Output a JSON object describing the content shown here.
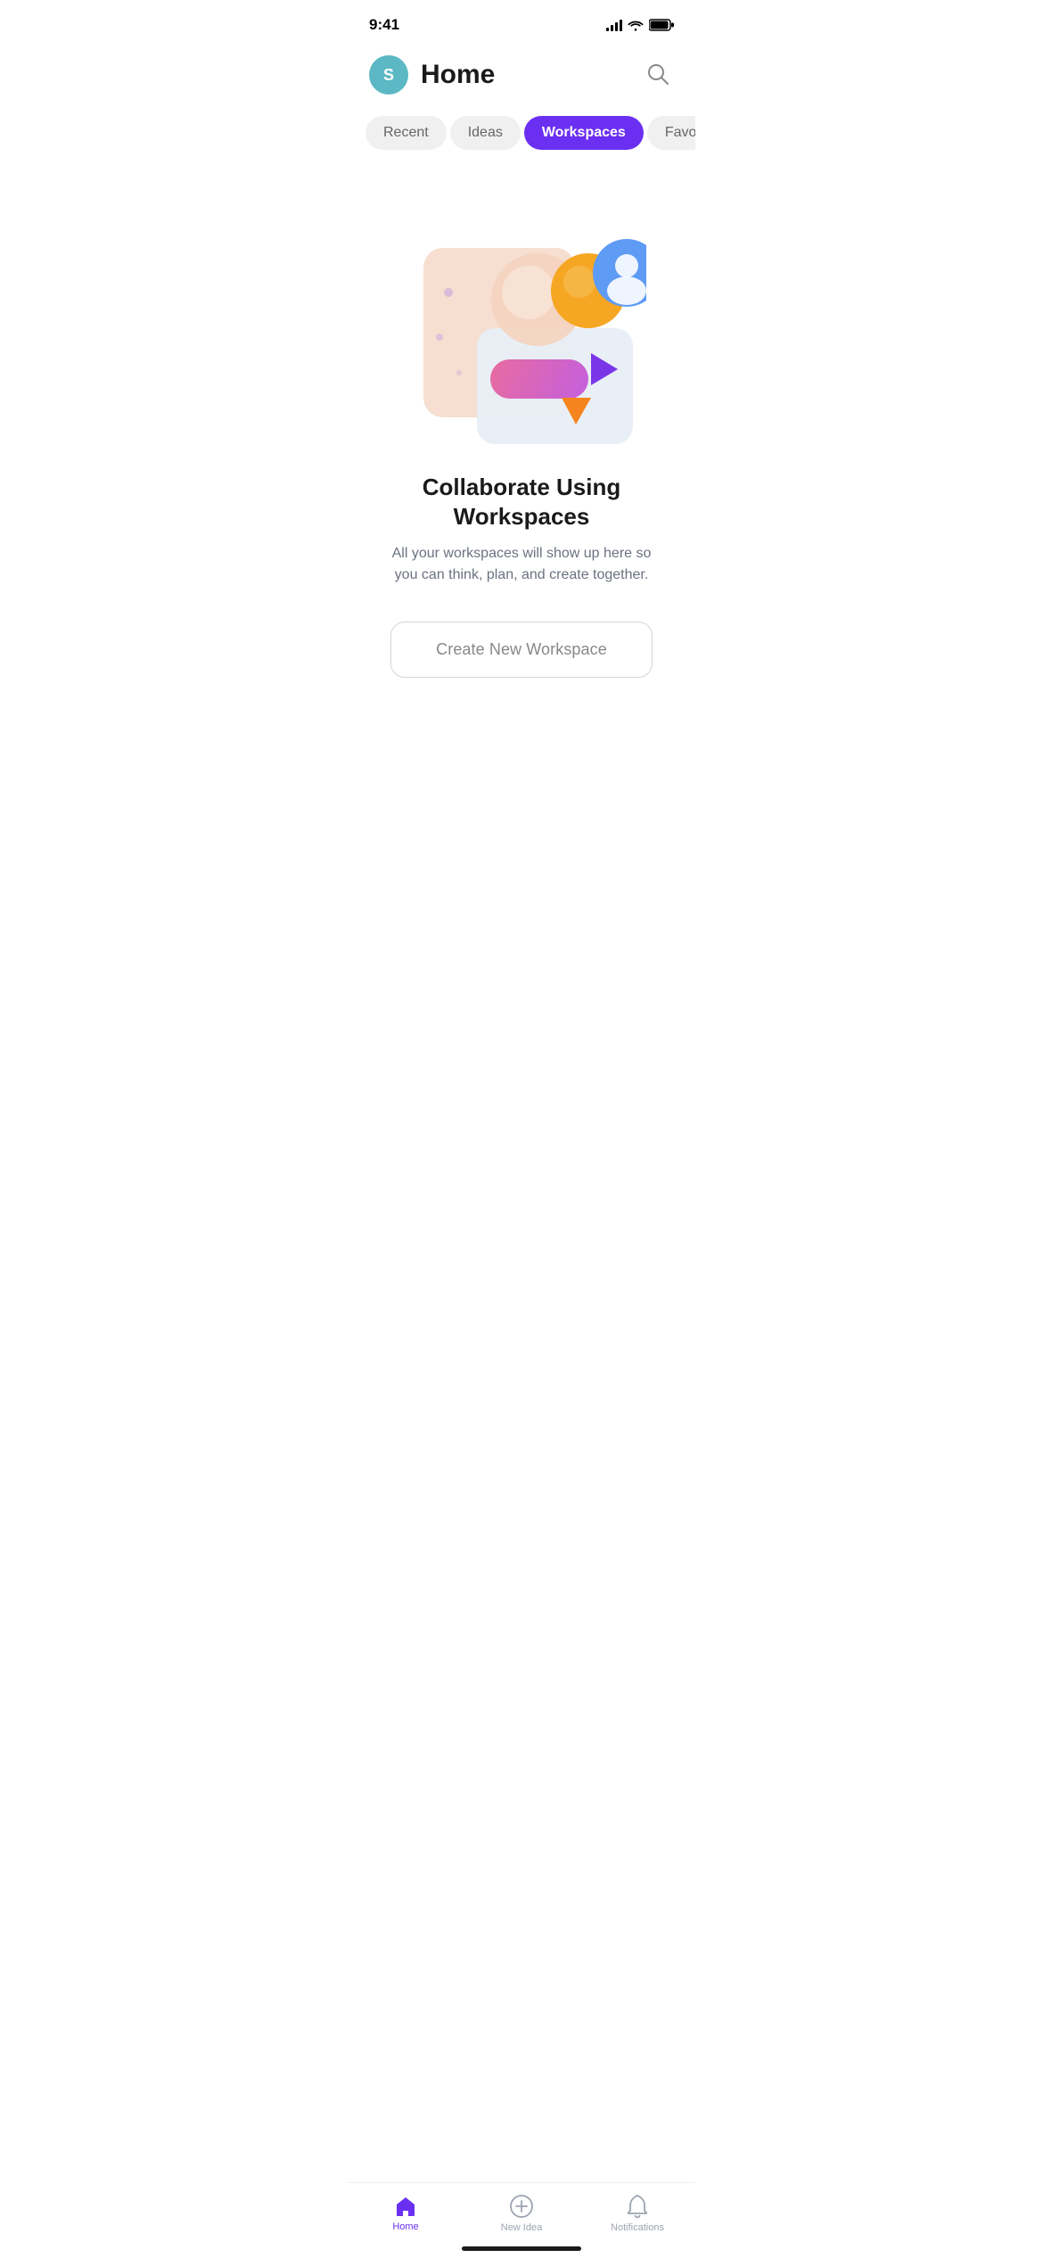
{
  "statusBar": {
    "time": "9:41"
  },
  "header": {
    "avatarLetter": "S",
    "title": "Home"
  },
  "tabs": [
    {
      "id": "recent",
      "label": "Recent",
      "active": false
    },
    {
      "id": "ideas",
      "label": "Ideas",
      "active": false
    },
    {
      "id": "workspaces",
      "label": "Workspaces",
      "active": true
    },
    {
      "id": "favourites",
      "label": "Favourites",
      "active": false
    }
  ],
  "main": {
    "heading": "Collaborate Using Workspaces",
    "description": "All your workspaces will show up here so you can think, plan, and create together.",
    "createButton": "Create New Workspace"
  },
  "bottomNav": [
    {
      "id": "home",
      "label": "Home",
      "active": true
    },
    {
      "id": "new-idea",
      "label": "New Idea",
      "active": false
    },
    {
      "id": "notifications",
      "label": "Notifications",
      "active": false
    }
  ],
  "colors": {
    "accent": "#6B2FF2",
    "avatarBg": "#5BB8C4"
  }
}
